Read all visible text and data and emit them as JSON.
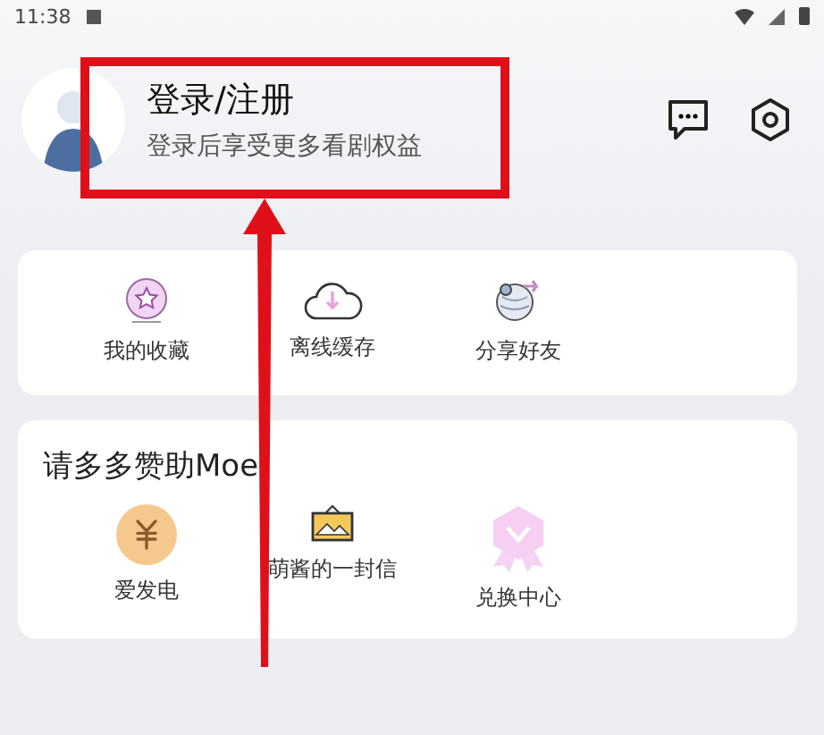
{
  "status_bar": {
    "time": "11:38"
  },
  "profile": {
    "title": "登录/注册",
    "subtitle": "登录后享受更多看剧权益"
  },
  "quick_actions": [
    {
      "kind": "favorites",
      "label": "我的收藏"
    },
    {
      "kind": "offline",
      "label": "离线缓存"
    },
    {
      "kind": "share",
      "label": "分享好友"
    }
  ],
  "support": {
    "title": "请多多赞助Moe",
    "items": [
      {
        "kind": "donate",
        "label": "爱发电"
      },
      {
        "kind": "letter",
        "label": "萌酱的一封信"
      },
      {
        "kind": "redeem",
        "label": "兑换中心"
      }
    ]
  }
}
